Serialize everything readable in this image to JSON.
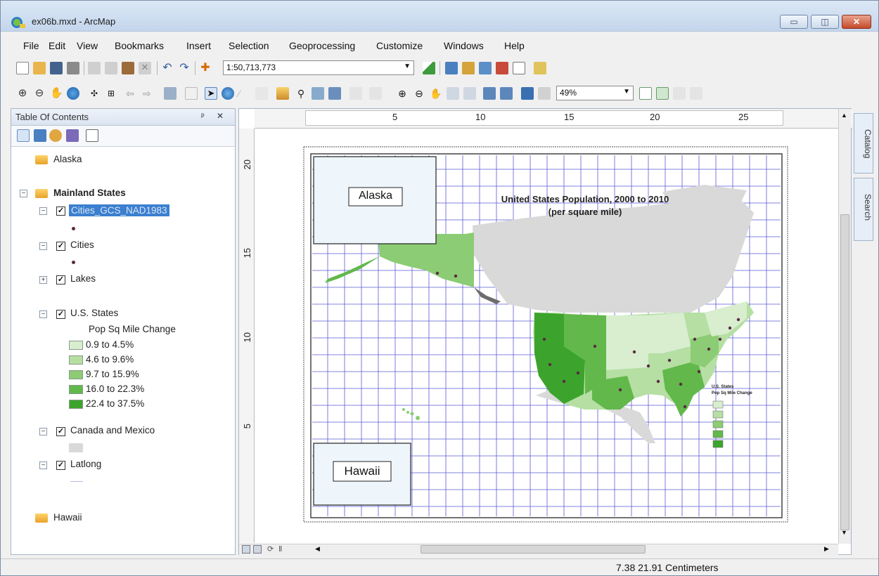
{
  "window": {
    "title": "ex06b.mxd - ArcMap",
    "minimize": "▭",
    "restore": "◫",
    "close": "✕"
  },
  "menu": [
    "File",
    "Edit",
    "View",
    "Bookmarks",
    "Insert",
    "Selection",
    "Geoprocessing",
    "Customize",
    "Windows",
    "Help"
  ],
  "toolbar": {
    "scale": "1:50,713,773",
    "zoom": "49%"
  },
  "toc": {
    "title": "Table Of Contents",
    "pin": "ᵖ",
    "close": "✕",
    "layers": {
      "alaska": "Alaska",
      "mainland": "Mainland States",
      "cities_gcs": "Cities_GCS_NAD1983",
      "cities": "Cities",
      "lakes": "Lakes",
      "us_states": "U.S. States",
      "pop_field": "Pop Sq Mile Change",
      "legend": [
        "0.9 to 4.5%",
        "4.6 to 9.6%",
        "9.7 to 15.9%",
        "16.0 to 22.3%",
        "22.4 to 37.5%"
      ],
      "canada_mexico": "Canada and Mexico",
      "latlong": "Latlong",
      "hawaii": "Hawaii"
    }
  },
  "map": {
    "title_line1": "United States Population, 2000 to 2010",
    "title_line2": "(per square mile)",
    "alaska_label": "Alaska",
    "hawaii_label": "Hawaii",
    "ruler_top": [
      "5",
      "10",
      "15",
      "20",
      "25"
    ],
    "ruler_left": [
      "20",
      "15",
      "10",
      "5"
    ],
    "mini_legend_title": "U.S. States",
    "mini_legend_sub": "Pop Sq Mile Change"
  },
  "side_tabs": [
    "Catalog",
    "Search"
  ],
  "status": {
    "coords": "7.38  21.91 Centimeters"
  },
  "colors": {
    "c1": "#d8eecf",
    "c2": "#b5dfa3",
    "c3": "#8ccc74",
    "c4": "#62b84b",
    "c5": "#3ca42c",
    "land": "#d9d9d9",
    "grid": "#5a5ad6"
  }
}
